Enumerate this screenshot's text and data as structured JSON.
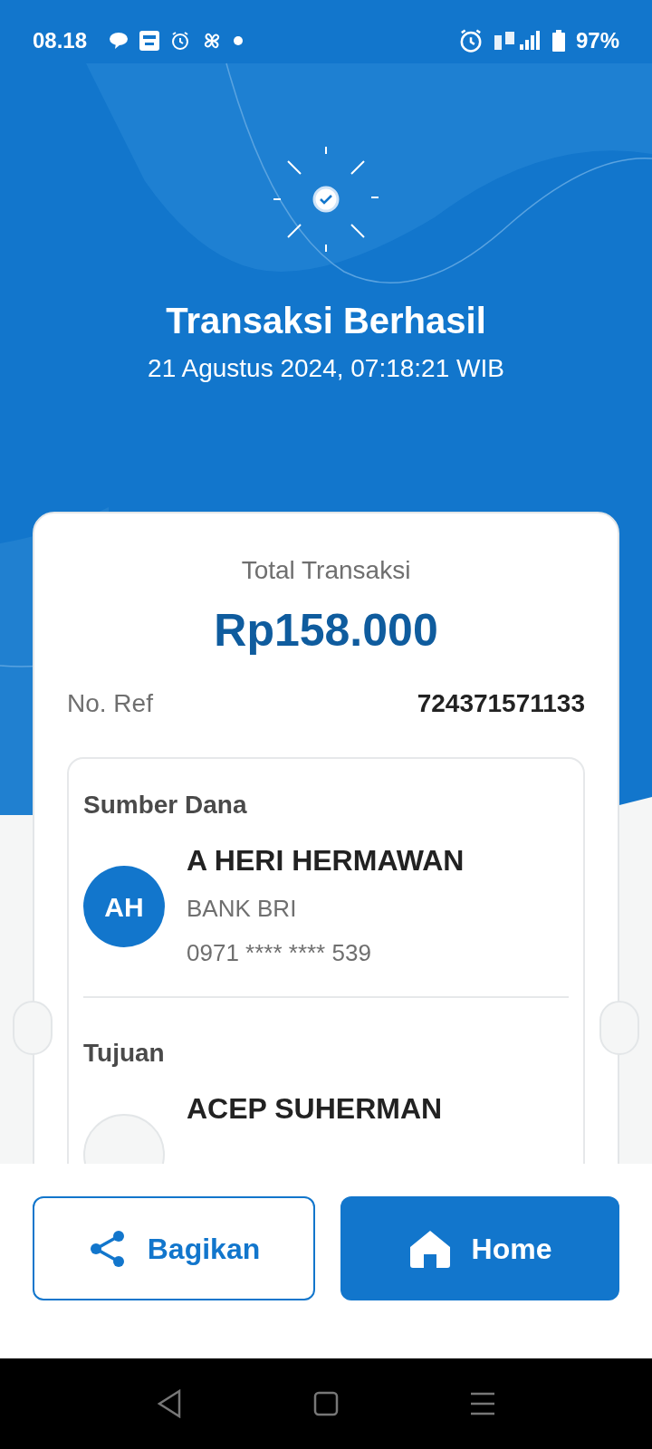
{
  "status_bar": {
    "time": "08.18",
    "battery": "97%"
  },
  "header": {
    "title": "Transaksi Berhasil",
    "datetime": "21 Agustus 2024, 07:18:21 WIB"
  },
  "receipt": {
    "total_label": "Total Transaksi",
    "total_amount": "Rp158.000",
    "ref_label": "No. Ref",
    "ref_value": "724371571133",
    "parties": [
      {
        "heading": "Sumber Dana",
        "initials": "AH",
        "name": "A HERI HERMAWAN",
        "bank": "BANK BRI",
        "account": "0971 **** **** 539"
      },
      {
        "heading": "Tujuan",
        "name": "ACEP SUHERMAN"
      }
    ]
  },
  "buttons": [
    {
      "kind": "share",
      "label": "Bagikan"
    },
    {
      "kind": "home",
      "label": "Home"
    }
  ]
}
